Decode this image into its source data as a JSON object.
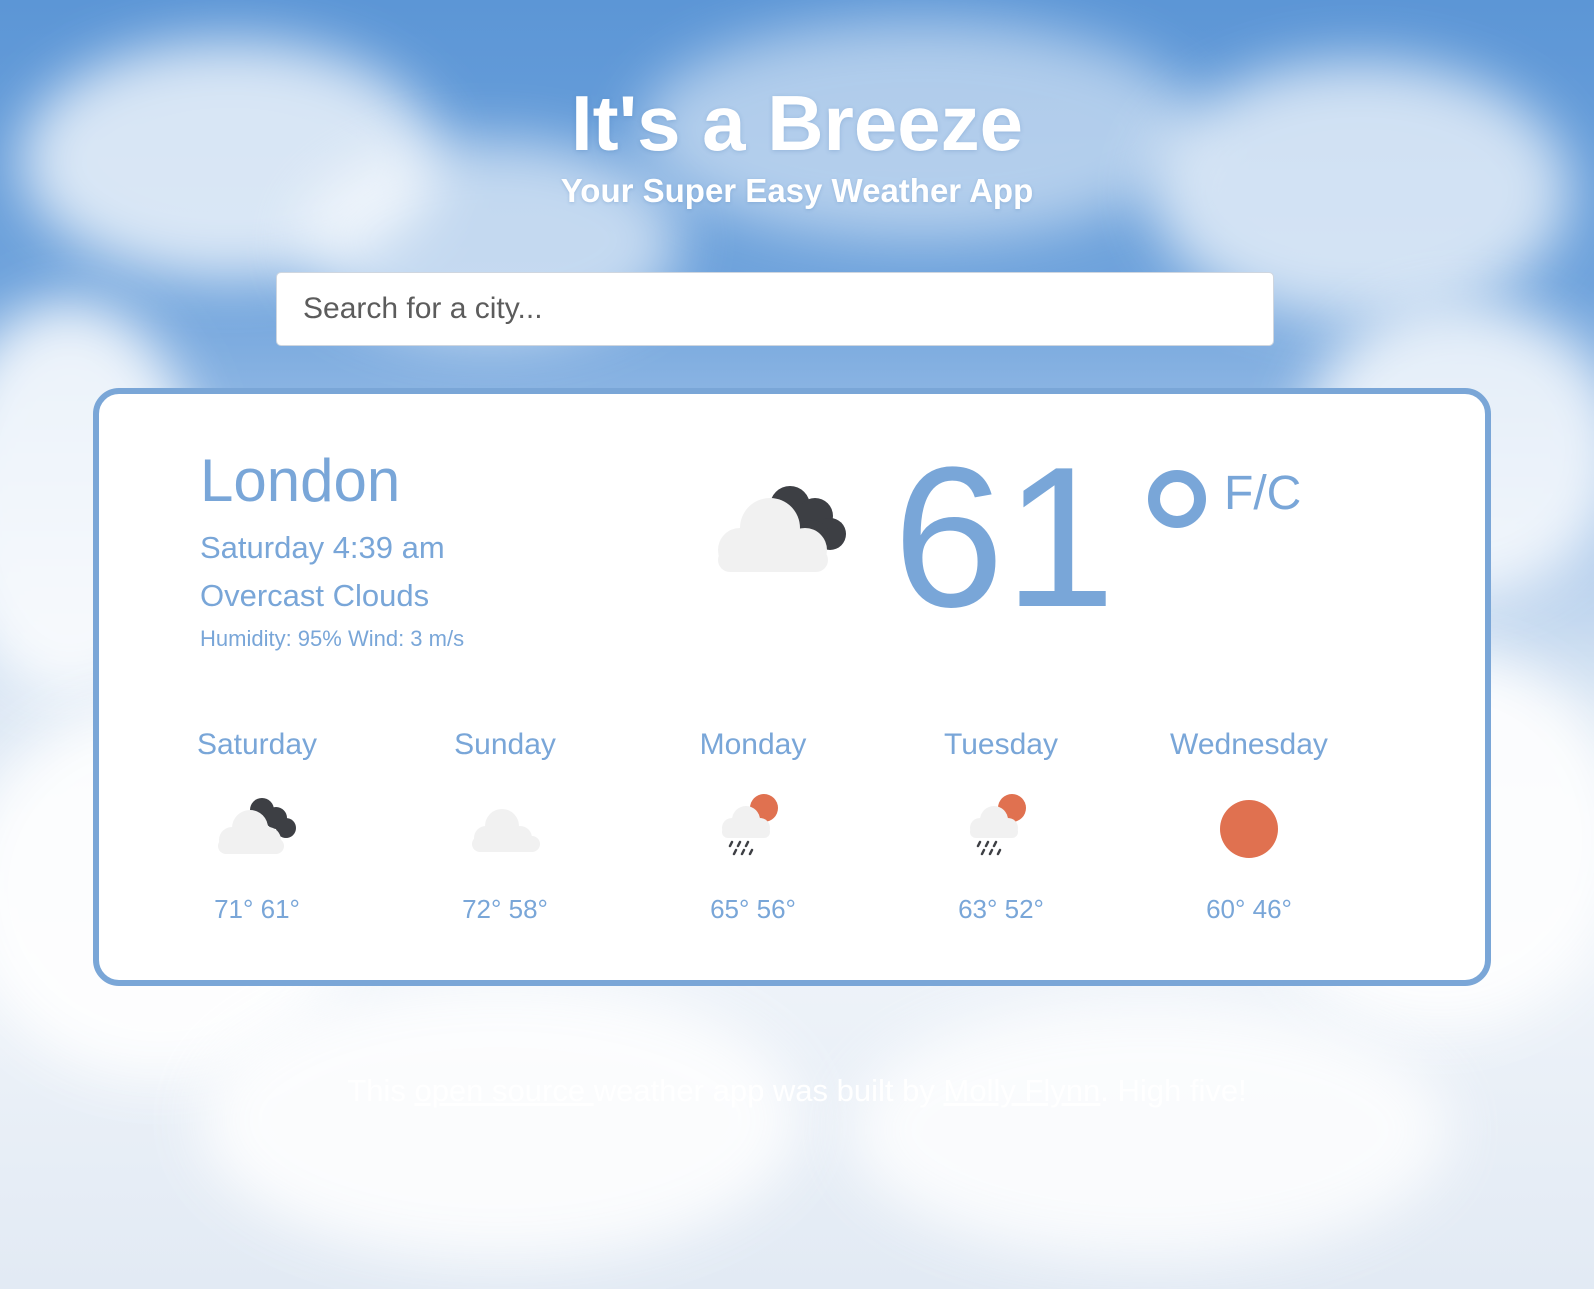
{
  "header": {
    "title": "It's a Breeze",
    "subtitle": "Your Super Easy Weather App"
  },
  "search": {
    "placeholder": "Search for a city..."
  },
  "current": {
    "city": "London",
    "datetime": "Saturday 4:39 am",
    "description": "Overcast Clouds",
    "details": "Humidity: 95% Wind: 3 m/s",
    "temperature": "61",
    "units": "F/C",
    "icon": "overcast-clouds-icon"
  },
  "forecast": [
    {
      "day": "Saturday",
      "temps": "71° 61°",
      "icon": "overcast-clouds-icon"
    },
    {
      "day": "Sunday",
      "temps": "72° 58°",
      "icon": "cloud-icon"
    },
    {
      "day": "Monday",
      "temps": "65° 56°",
      "icon": "sun-rain-cloud-icon"
    },
    {
      "day": "Tuesday",
      "temps": "63° 52°",
      "icon": "sun-rain-cloud-icon"
    },
    {
      "day": "Wednesday",
      "temps": "60° 46°",
      "icon": "sun-icon"
    }
  ],
  "footer": {
    "prefix": "This ",
    "link1": "open source ",
    "middle": "weather app was built by ",
    "link2": "Molly Flynn",
    "suffix": ". High five!"
  },
  "colors": {
    "accent": "#79a6d8",
    "sun": "#e07150",
    "dark_cloud": "#3d3f44",
    "light_cloud": "#f1f1f1"
  }
}
